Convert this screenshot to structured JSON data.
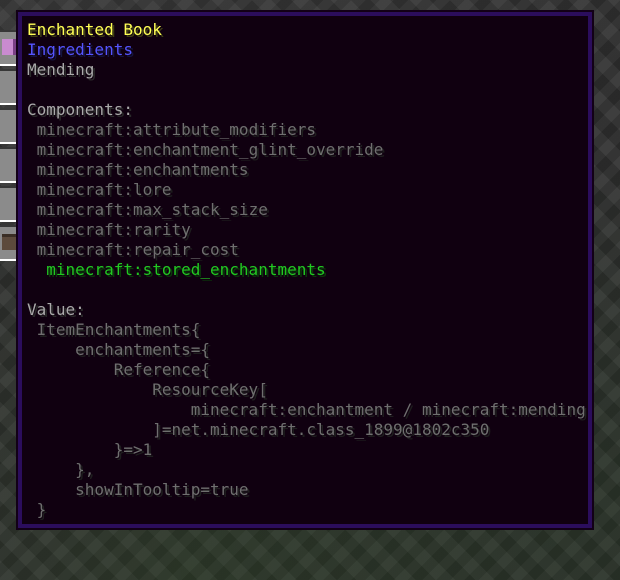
{
  "tooltip": {
    "title": "Enchanted Book",
    "category": "Ingredients",
    "enchantment": "Mending",
    "components_header": "Components:",
    "components": [
      "minecraft:attribute_modifiers",
      "minecraft:enchantment_glint_override",
      "minecraft:enchantments",
      "minecraft:lore",
      "minecraft:max_stack_size",
      "minecraft:rarity",
      "minecraft:repair_cost"
    ],
    "selected_component": "minecraft:stored_enchantments",
    "value_header": "Value:",
    "value_lines": [
      " ItemEnchantments{",
      "     enchantments={",
      "         Reference{",
      "             ResourceKey[",
      "                 minecraft:enchantment / minecraft:mending",
      "             ]=net.minecraft.class_1899@1802c350",
      "         }=>1",
      "     },",
      "     showInTooltip=true",
      " }"
    ]
  },
  "colors": {
    "title": "#ffff55",
    "category": "#5555ff",
    "text": "#aaaaaa",
    "dim": "#6f6f6f",
    "selected": "#22c822",
    "tooltip_bg": "#100010",
    "tooltip_border": "#2b0d5c"
  },
  "inventory": {
    "slot_icons": [
      "enchanted-book-icon",
      "",
      "",
      "",
      "",
      "block-icon"
    ]
  }
}
